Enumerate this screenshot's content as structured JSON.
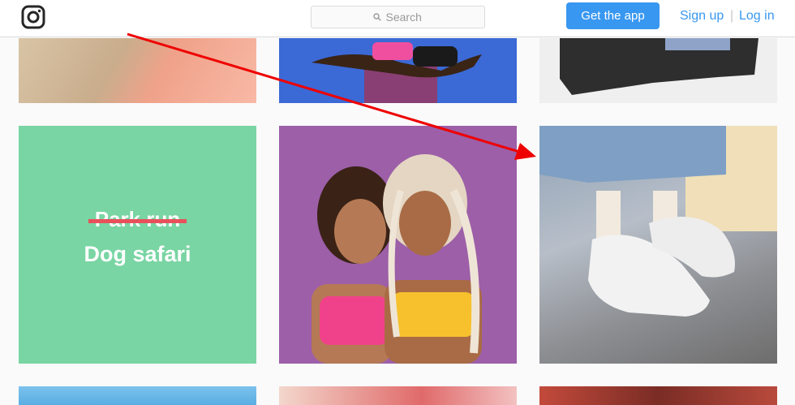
{
  "header": {
    "logo_icon": "instagram-logo-icon",
    "search_placeholder": "Search",
    "search_icon": "search-icon",
    "get_app_label": "Get the app",
    "signup_label": "Sign up",
    "separator": "|",
    "login_label": "Log in"
  },
  "grid": {
    "row1": [
      "photo-toys",
      "photo-woman-stretching",
      "photo-jeans"
    ],
    "row2": [
      "photo-text-graphic",
      "photo-two-women",
      "photo-sneakers"
    ],
    "row3": [
      "photo-sky",
      "photo-red-wall",
      "photo-brick-building"
    ]
  },
  "text_tile": {
    "struck_text": "Park run",
    "main_text": "Dog safari"
  },
  "colors": {
    "accent": "#3897f0",
    "annotation_arrow": "#ee0000",
    "tile_green": "#79d5a3",
    "strike_red": "#e8505b"
  }
}
